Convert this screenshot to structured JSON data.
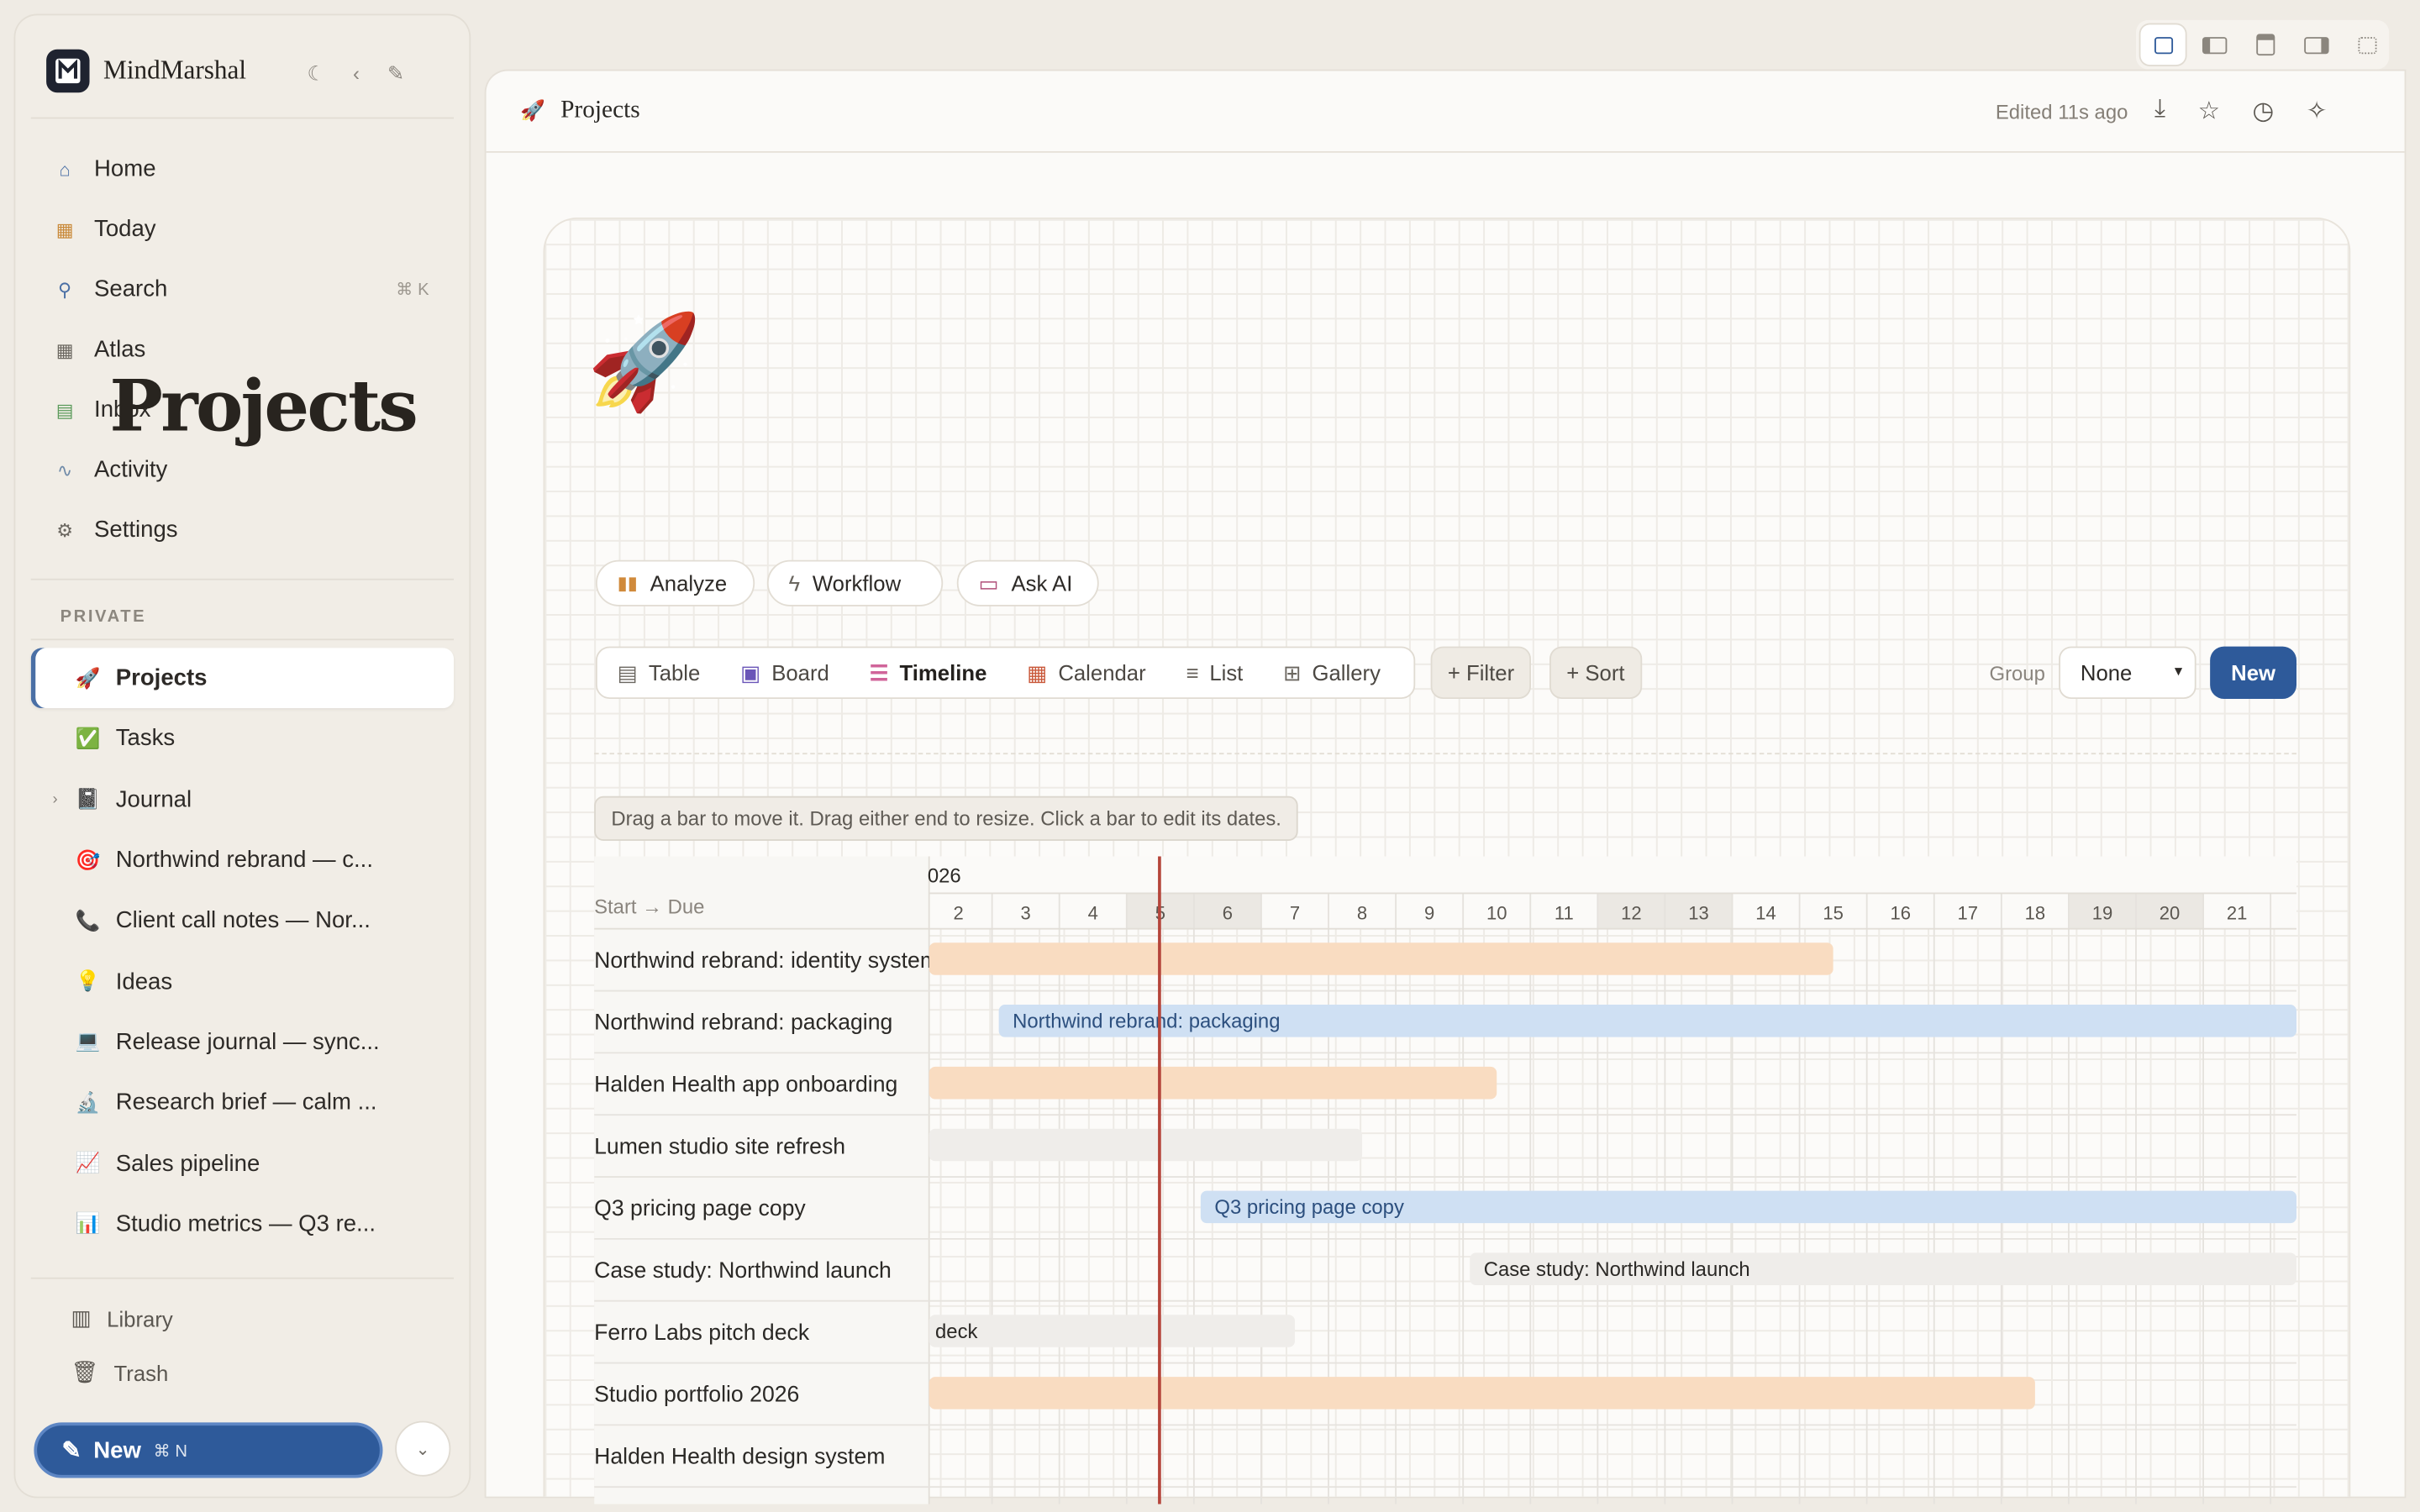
{
  "app": {
    "name": "MindMarshal"
  },
  "sidebar": {
    "nav": [
      {
        "label": "Home",
        "icon": "home-icon"
      },
      {
        "label": "Today",
        "icon": "calendar-icon"
      },
      {
        "label": "Search",
        "icon": "search-icon",
        "shortcut": "⌘ K"
      },
      {
        "label": "Atlas",
        "icon": "grid-icon"
      },
      {
        "label": "Inbox",
        "icon": "inbox-icon"
      },
      {
        "label": "Activity",
        "icon": "activity-icon"
      },
      {
        "label": "Settings",
        "icon": "gear-icon"
      }
    ],
    "section_label": "PRIVATE",
    "pages": [
      {
        "label": "Projects",
        "icon": "🚀",
        "active": true
      },
      {
        "label": "Tasks",
        "icon": "✅"
      },
      {
        "label": "Journal",
        "icon": "📓"
      },
      {
        "label": "Northwind rebrand — c...",
        "icon": "🎯"
      },
      {
        "label": "Client call notes — Nor...",
        "icon": "📞"
      },
      {
        "label": "Ideas",
        "icon": "💡"
      },
      {
        "label": "Release journal — sync...",
        "icon": "💻"
      },
      {
        "label": "Research brief — calm ...",
        "icon": "🔬"
      },
      {
        "label": "Sales pipeline",
        "icon": "📈"
      },
      {
        "label": "Studio metrics — Q3 re...",
        "icon": "📊"
      }
    ],
    "footer": [
      {
        "label": "Library",
        "icon": "library-icon"
      },
      {
        "label": "Trash",
        "icon": "trash-icon"
      }
    ],
    "new_button": {
      "label": "New",
      "shortcut": "⌘ N"
    }
  },
  "header": {
    "title": "Projects",
    "emoji": "🚀",
    "edited": "Edited 11s ago"
  },
  "page": {
    "emoji": "🚀",
    "title": "Projects",
    "actions": [
      {
        "label": "Analyze",
        "icon": "bar-chart-icon"
      },
      {
        "label": "Workflow",
        "icon": "bolt-icon"
      },
      {
        "label": "Ask AI",
        "icon": "chat-icon"
      }
    ],
    "views": [
      {
        "label": "Table",
        "icon": "table-icon"
      },
      {
        "label": "Board",
        "icon": "board-icon"
      },
      {
        "label": "Timeline",
        "icon": "timeline-icon",
        "active": true
      },
      {
        "label": "Calendar",
        "icon": "calendar-icon"
      },
      {
        "label": "List",
        "icon": "list-icon"
      },
      {
        "label": "Gallery",
        "icon": "gallery-icon"
      }
    ],
    "filter_label": "+ Filter",
    "sort_label": "+ Sort",
    "group_label": "Group",
    "group_value": "None",
    "new_label": "New",
    "hint": "Drag a bar to move it. Drag either end to resize. Click a bar to edit its dates."
  },
  "timeline": {
    "column_header": "Start → Due",
    "year_label": "026",
    "days": [
      "2",
      "3",
      "4",
      "5",
      "6",
      "7",
      "8",
      "9",
      "10",
      "11",
      "12",
      "13",
      "14",
      "15",
      "16",
      "17",
      "18",
      "19",
      "20",
      "21"
    ],
    "weekend_days": [
      "5",
      "6",
      "12",
      "13",
      "19",
      "20"
    ],
    "today": "5",
    "rows": [
      {
        "name": "Northwind rebrand: identity system",
        "start": 1,
        "end": 15,
        "color": "orange",
        "bar_label": ""
      },
      {
        "name": "Northwind rebrand: packaging",
        "start": 3.1,
        "end": 23,
        "color": "blue",
        "bar_label": "Northwind rebrand: packaging"
      },
      {
        "name": "Halden Health app onboarding",
        "start": 1,
        "end": 10,
        "color": "orange",
        "bar_label": ""
      },
      {
        "name": "Lumen studio site refresh",
        "start": 1,
        "end": 8,
        "color": "gray",
        "bar_label": ""
      },
      {
        "name": "Q3 pricing page copy",
        "start": 6.1,
        "end": 23,
        "color": "blue",
        "bar_label": "Q3 pricing page copy"
      },
      {
        "name": "Case study: Northwind launch",
        "start": 10.1,
        "end": 23,
        "color": "gray",
        "bar_label": "Case study: Northwind launch"
      },
      {
        "name": "Ferro Labs pitch deck",
        "start": 1,
        "end": 7,
        "color": "gray",
        "bar_label": "deck"
      },
      {
        "name": "Studio portfolio 2026",
        "start": 1,
        "end": 18,
        "color": "orange",
        "bar_label": ""
      },
      {
        "name": "Halden Health design system",
        "start": null,
        "end": null,
        "color": "",
        "bar_label": ""
      }
    ],
    "colors": {
      "orange": "#f9dcc1",
      "blue": "#cfe0f3",
      "gray": "#efedea",
      "today_line": "#b5453b"
    }
  }
}
